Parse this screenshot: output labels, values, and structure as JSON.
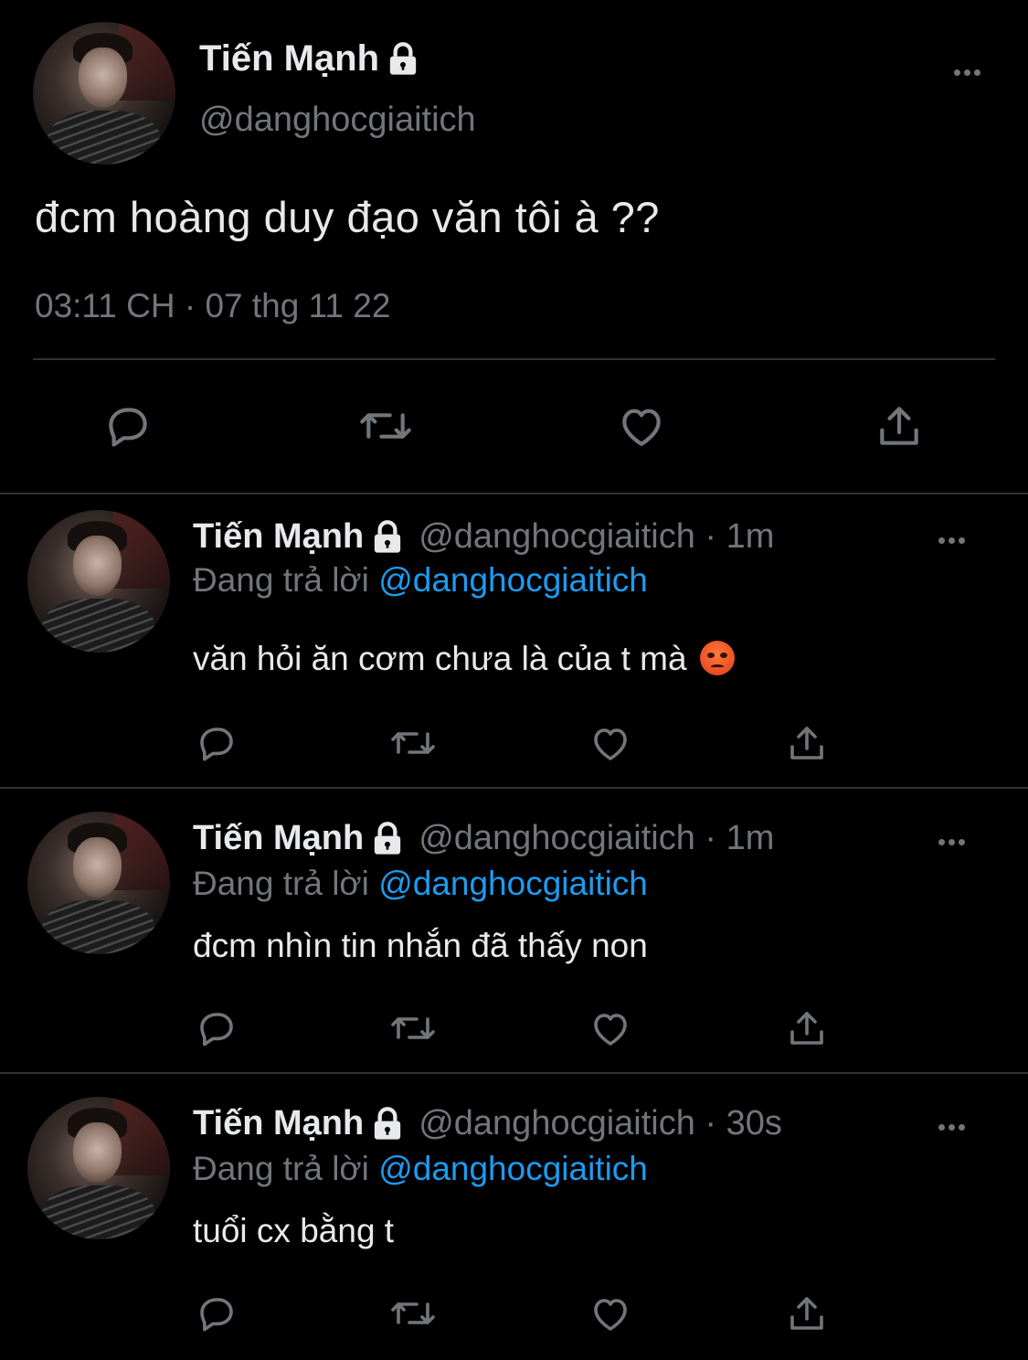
{
  "main_tweet": {
    "display_name": "Tiến Mạnh",
    "handle": "@danghocgiaitich",
    "text": "đcm hoàng duy đạo văn tôi à ??",
    "timestamp": "03:11 CH · 07 thg 11 22",
    "icons": [
      "lock-icon",
      "more-icon",
      "reply-icon",
      "retweet-icon",
      "like-icon",
      "share-icon"
    ]
  },
  "replies": [
    {
      "display_name": "Tiến Mạnh",
      "handle_time": "@danghocgiaitich · 1m",
      "replying_prefix": "Đang trả lời",
      "replying_to": "@danghocgiaitich",
      "text": "văn hỏi ăn cơm chưa là của t mà",
      "emoji": "angry-face-emoji"
    },
    {
      "display_name": "Tiến Mạnh",
      "handle_time": "@danghocgiaitich · 1m",
      "replying_prefix": "Đang trả lời",
      "replying_to": "@danghocgiaitich",
      "text": "đcm nhìn tin nhắn đã thấy non"
    },
    {
      "display_name": "Tiến Mạnh",
      "handle_time": "@danghocgiaitich · 30s",
      "replying_prefix": "Đang trả lời",
      "replying_to": "@danghocgiaitich",
      "text": "tuổi cx bằng t"
    }
  ],
  "colors": {
    "background": "#000000",
    "text": "#e7e9ea",
    "secondary": "#71767b",
    "accent": "#1d9bf0",
    "divider": "#2f3336"
  }
}
